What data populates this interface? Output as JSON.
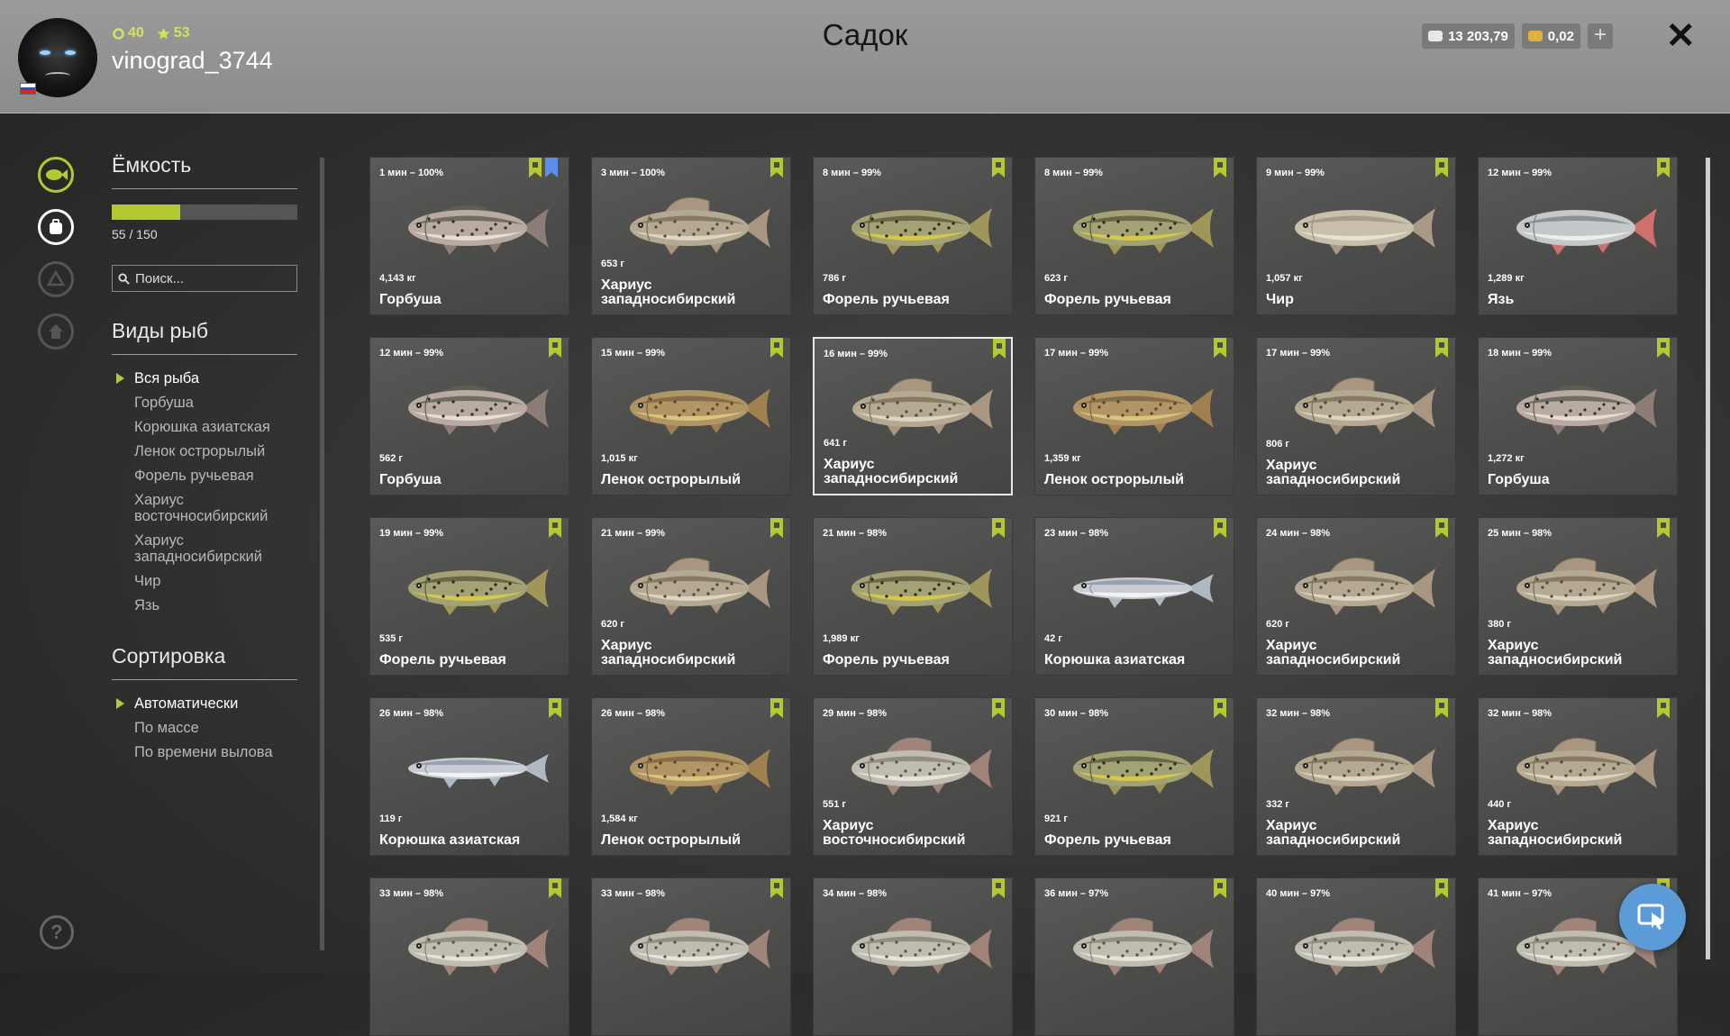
{
  "header": {
    "title": "Садок",
    "username": "vinograd_3744",
    "level": "40",
    "stars": "53",
    "silver": "13 203,79",
    "gold": "0,02",
    "add_label": "+",
    "close_label": "✕"
  },
  "capacity": {
    "title": "Ёмкость",
    "text": "55 / 150",
    "fill_fraction": 0.367
  },
  "search": {
    "placeholder": "Поиск..."
  },
  "species": {
    "title": "Виды рыб",
    "items": [
      "Вся рыба",
      "Горбуша",
      "Корюшка азиатская",
      "Ленок острорылый",
      "Форель ручьевая",
      "Хариус восточносибирский",
      "Хариус западносибирский",
      "Чир",
      "Язь"
    ]
  },
  "sorting": {
    "title": "Сортировка",
    "items": [
      "Автоматически",
      "По массе",
      "По времени вылова"
    ]
  },
  "help_label": "?",
  "colors": {
    "accent": "#b4c832",
    "blue_accent": "#5a8ee8",
    "fab": "#5a9bd8"
  },
  "fish": [
    {
      "time": "1 мин – 100%",
      "weight": "4,143 кг",
      "name": "Горбуша",
      "type": "pink",
      "blue": true
    },
    {
      "time": "3 мин – 100%",
      "weight": "653 г",
      "name": "Хариус западносибирский",
      "type": "grayling"
    },
    {
      "time": "8 мин – 99%",
      "weight": "786 г",
      "name": "Форель ручьевая",
      "type": "trout"
    },
    {
      "time": "8 мин – 99%",
      "weight": "623 г",
      "name": "Форель ручьевая",
      "type": "trout"
    },
    {
      "time": "9 мин – 99%",
      "weight": "1,057 кг",
      "name": "Чир",
      "type": "whitefish"
    },
    {
      "time": "12 мин – 99%",
      "weight": "1,289 кг",
      "name": "Язь",
      "type": "ide"
    },
    {
      "time": "12 мин – 99%",
      "weight": "562 г",
      "name": "Горбуша",
      "type": "pink"
    },
    {
      "time": "15 мин – 99%",
      "weight": "1,015 кг",
      "name": "Ленок острорылый",
      "type": "lenok"
    },
    {
      "time": "16 мин – 99%",
      "weight": "641 г",
      "name": "Хариус западносибирский",
      "type": "grayling",
      "selected": true
    },
    {
      "time": "17 мин – 99%",
      "weight": "1,359 кг",
      "name": "Ленок острорылый",
      "type": "lenok"
    },
    {
      "time": "17 мин – 99%",
      "weight": "806 г",
      "name": "Хариус западносибирский",
      "type": "grayling"
    },
    {
      "time": "18 мин – 99%",
      "weight": "1,272 кг",
      "name": "Горбуша",
      "type": "pink"
    },
    {
      "time": "19 мин – 99%",
      "weight": "535 г",
      "name": "Форель ручьевая",
      "type": "trout"
    },
    {
      "time": "21 мин – 99%",
      "weight": "620 г",
      "name": "Хариус западносибирский",
      "type": "grayling"
    },
    {
      "time": "21 мин – 98%",
      "weight": "1,989 кг",
      "name": "Форель ручьевая",
      "type": "trout"
    },
    {
      "time": "23 мин – 98%",
      "weight": "42 г",
      "name": "Корюшка азиатская",
      "type": "smelt"
    },
    {
      "time": "24 мин – 98%",
      "weight": "620 г",
      "name": "Хариус западносибирский",
      "type": "grayling"
    },
    {
      "time": "25 мин – 98%",
      "weight": "380 г",
      "name": "Хариус западносибирский",
      "type": "grayling"
    },
    {
      "time": "26 мин – 98%",
      "weight": "119 г",
      "name": "Корюшка азиатская",
      "type": "smelt"
    },
    {
      "time": "26 мин – 98%",
      "weight": "1,584 кг",
      "name": "Ленок острорылый",
      "type": "lenok"
    },
    {
      "time": "29 мин – 98%",
      "weight": "551 г",
      "name": "Хариус восточносибирский",
      "type": "egrayling"
    },
    {
      "time": "30 мин – 98%",
      "weight": "921 г",
      "name": "Форель ручьевая",
      "type": "trout"
    },
    {
      "time": "32 мин – 98%",
      "weight": "332 г",
      "name": "Хариус западносибирский",
      "type": "grayling"
    },
    {
      "time": "32 мин – 98%",
      "weight": "440 г",
      "name": "Хариус западносибирский",
      "type": "grayling"
    },
    {
      "time": "33 мин – 98%",
      "weight": "",
      "name": "",
      "type": "egrayling"
    },
    {
      "time": "33 мин – 98%",
      "weight": "",
      "name": "",
      "type": "egrayling"
    },
    {
      "time": "34 мин – 98%",
      "weight": "",
      "name": "",
      "type": "egrayling"
    },
    {
      "time": "36 мин – 97%",
      "weight": "",
      "name": "",
      "type": "egrayling"
    },
    {
      "time": "40 мин – 97%",
      "weight": "",
      "name": "",
      "type": "egrayling"
    },
    {
      "time": "41 мин – 97%",
      "weight": "",
      "name": "",
      "type": "egrayling"
    }
  ]
}
